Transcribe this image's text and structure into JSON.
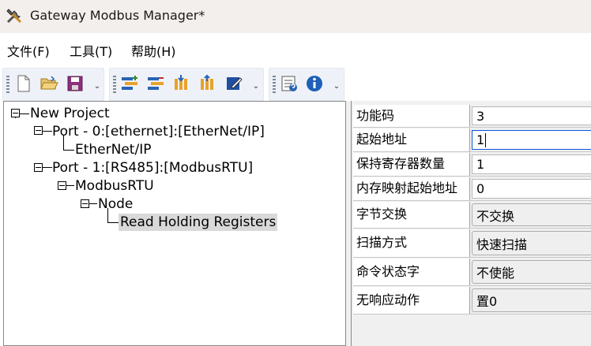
{
  "window": {
    "title": "Gateway Modbus Manager*"
  },
  "menu": [
    "文件(F)",
    "工具(T)",
    "帮助(H)"
  ],
  "toolbar": {
    "groups": [
      [
        "new-file-icon",
        "open-folder-icon",
        "save-icon"
      ],
      [
        "add-port-icon",
        "remove-port-icon",
        "import-icon",
        "export-icon",
        "edit-icon"
      ],
      [
        "properties-icon",
        "about-icon"
      ]
    ],
    "overflow_glyph": "⌄",
    "colors": {
      "group_bg": "#eef2f8",
      "accent_blue": "#2a64b4",
      "accent_orange": "#e7a22b",
      "accent_purple": "#8d2e7d"
    }
  },
  "tree": {
    "root": "New Project",
    "port0": "Port - 0:[ethernet]:[EtherNet/IP]",
    "port0_child": "EtherNet/IP",
    "port1": "Port - 1:[RS485]:[ModbusRTU]",
    "modbus": "ModbusRTU",
    "node": "Node",
    "selected": "Read Holding Registers"
  },
  "properties": [
    {
      "name": "功能码",
      "value": "3",
      "type": "text"
    },
    {
      "name": "起始地址",
      "value": "1",
      "type": "text-focused"
    },
    {
      "name": "保持寄存器数量",
      "value": "1",
      "type": "text"
    },
    {
      "name": "内存映射起始地址",
      "value": "0",
      "type": "text"
    },
    {
      "name": "字节交换",
      "value": "不交换",
      "type": "select"
    },
    {
      "name": "扫描方式",
      "value": "快速扫描",
      "type": "select"
    },
    {
      "name": "命令状态字",
      "value": "不使能",
      "type": "select"
    },
    {
      "name": "无响应动作",
      "value": "置0",
      "type": "select"
    }
  ]
}
